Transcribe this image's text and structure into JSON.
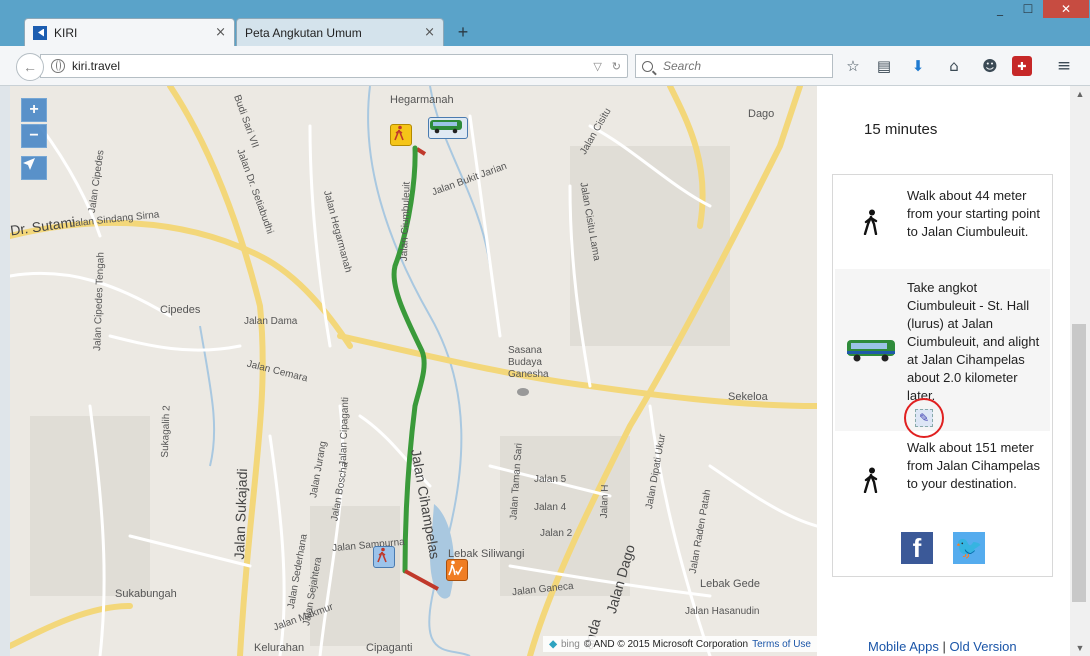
{
  "browser": {
    "tabs": [
      {
        "title": "KIRI",
        "active": true
      },
      {
        "title": "Peta Angkutan Umum",
        "active": false
      }
    ],
    "new_tab_label": "+",
    "close_label": "×",
    "url": "kiri.travel",
    "search_placeholder": "Search",
    "window_controls": {
      "minimize": "_",
      "maximize": "☐",
      "close": "✕"
    }
  },
  "map": {
    "zoom_in": "+",
    "zoom_out": "−",
    "attribution": {
      "bing": "bing",
      "copyright": "© AND © 2015 Microsoft Corporation",
      "terms": "Terms of Use"
    },
    "labels": {
      "hegarmanah": "Hegarmanah",
      "dago_top": "Dago",
      "dr_sutami": "Dr. Sutami",
      "jalan_sindang_sirna": "Jalan Sindang Sirna",
      "cipedes": "Cipedes",
      "jalan_dama": "Jalan Dama",
      "jalan_cemara": "Jalan Cemara",
      "sasana": "Sasana",
      "budaya": "Budaya",
      "ganesha": "Ganesha",
      "sekeloa": "Sekeloa",
      "jalan_sukajadi": "Jalan Sukajadi",
      "jalan_cipaganti": "Jalan Cipaganti",
      "jalan_cihampelas": "Jalan Cihampelas",
      "jalan_taman_sari": "Jalan Taman Sari",
      "jalan_5": "Jalan 5",
      "jalan_4": "Jalan 4",
      "jalan_2": "Jalan 2",
      "lebak_siliwangi": "Lebak Siliwangi",
      "jalan_dago": "Jalan Dago",
      "jalan_ganeca": "Jalan Ganeca",
      "lebak_gede": "Lebak Gede",
      "jalan_hasanudin": "Jalan Hasanudin",
      "sukabungah": "Sukabungah",
      "jalan_dipati_ukur": "Jalan Dipati Ukur",
      "jalan_cisitu": "Jalan Cisitu",
      "jalan_bukit_jarian": "Jalan Bukit Jarian",
      "jalan_hegarmanah": "Jalan Hegarmanah",
      "jalan_cipedes": "Jalan Cipedes",
      "jalan_cipedes_tengah": "Jalan Cipedes Tengah",
      "jalan_sampurna": "Jalan Sampurna",
      "jalan_bosha": "Jalan Boscha",
      "jalan_jurang": "Jalan Jurang",
      "jalan_makmur": "Jalan Makmur",
      "jalan_dr_setiabudhi": "Jalan Dr. Setiabudhi",
      "budi_sari": "Budi Sari VII",
      "kelurahan": "Kelurahan",
      "cipaganti": "Cipaganti",
      "sukagalih": "Sukagalih 2",
      "jalan_dipati": "Jalan Dipati Ukur",
      "jalan_raden_patah": "Jalan Raden Patah",
      "jalan_h": "Jalan H",
      "jalan_cisitu_lama": "Jalan Cisitu Lama",
      "jalan_ciumbuleuit": "Jalan Ciumbuleuit",
      "manda": "anda",
      "jalan_sederhana": "Jalan Sederhana",
      "jalan_sejahtera": "Jalan Sejahtera"
    }
  },
  "route": {
    "duration": "15 minutes",
    "steps": [
      {
        "icon": "walk-icon",
        "text": "Walk about 44 meter from your starting point to Jalan Ciumbuleuit."
      },
      {
        "icon": "angkot-icon",
        "text": "Take angkot Ciumbuleuit - St. Hall (lurus) at Jalan Ciumbuleuit, and alight at Jalan Cihampelas about 2.0 kilometer later."
      },
      {
        "icon": "walk-icon",
        "text": "Walk about 151 meter from Jalan Cihampelas to your destination."
      }
    ],
    "social": {
      "facebook": "f",
      "twitter": "t"
    },
    "footer": {
      "mobile_apps": "Mobile Apps",
      "separator": " | ",
      "old_version": "Old Version"
    }
  },
  "colors": {
    "tabbar": "#5aa3c9",
    "route_green": "#3a9a3a",
    "walk_red": "#c0392b",
    "facebook": "#3b5998",
    "twitter": "#55acee",
    "link": "#1a55a8"
  }
}
